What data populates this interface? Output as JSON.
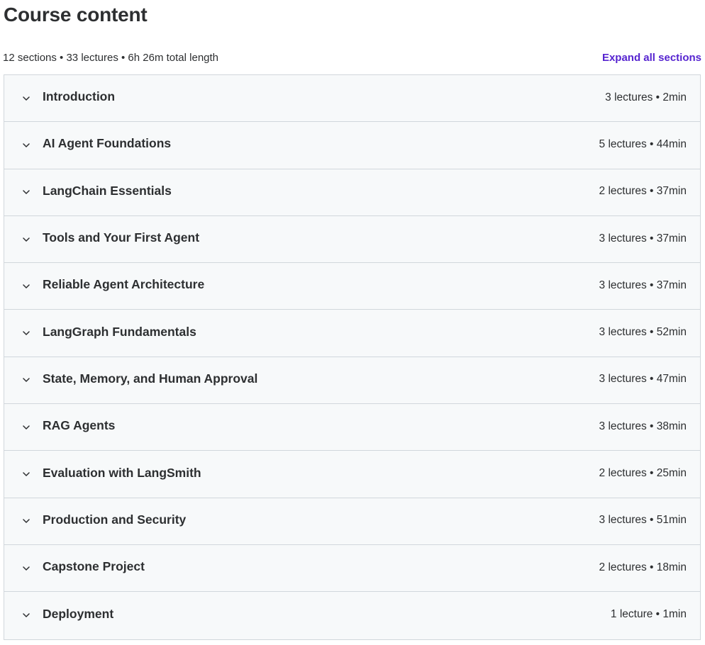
{
  "header": {
    "title": "Course content",
    "summary": "12 sections • 33 lectures • 6h 26m total length",
    "expand_all_label": "Expand all sections"
  },
  "colors": {
    "accent": "#5624d0",
    "text": "#2d2f31",
    "section_bg": "#f7f9fa",
    "border": "#d1d7dc"
  },
  "sections": [
    {
      "title": "Introduction",
      "meta": "3 lectures • 2min",
      "icon": "chevron-down-icon"
    },
    {
      "title": "AI Agent Foundations",
      "meta": "5 lectures • 44min",
      "icon": "chevron-down-icon"
    },
    {
      "title": "LangChain Essentials",
      "meta": "2 lectures • 37min",
      "icon": "chevron-down-icon"
    },
    {
      "title": "Tools and Your First Agent",
      "meta": "3 lectures • 37min",
      "icon": "chevron-down-icon"
    },
    {
      "title": "Reliable Agent Architecture",
      "meta": "3 lectures • 37min",
      "icon": "chevron-down-icon"
    },
    {
      "title": "LangGraph Fundamentals",
      "meta": "3 lectures • 52min",
      "icon": "chevron-down-icon"
    },
    {
      "title": "State, Memory, and Human Approval",
      "meta": "3 lectures • 47min",
      "icon": "chevron-down-icon"
    },
    {
      "title": "RAG Agents",
      "meta": "3 lectures • 38min",
      "icon": "chevron-down-icon"
    },
    {
      "title": "Evaluation with LangSmith",
      "meta": "2 lectures • 25min",
      "icon": "chevron-down-icon"
    },
    {
      "title": "Production and Security",
      "meta": "3 lectures • 51min",
      "icon": "chevron-down-icon"
    },
    {
      "title": "Capstone Project",
      "meta": "2 lectures • 18min",
      "icon": "chevron-down-icon"
    },
    {
      "title": "Deployment",
      "meta": "1 lecture • 1min",
      "icon": "chevron-down-icon"
    }
  ]
}
